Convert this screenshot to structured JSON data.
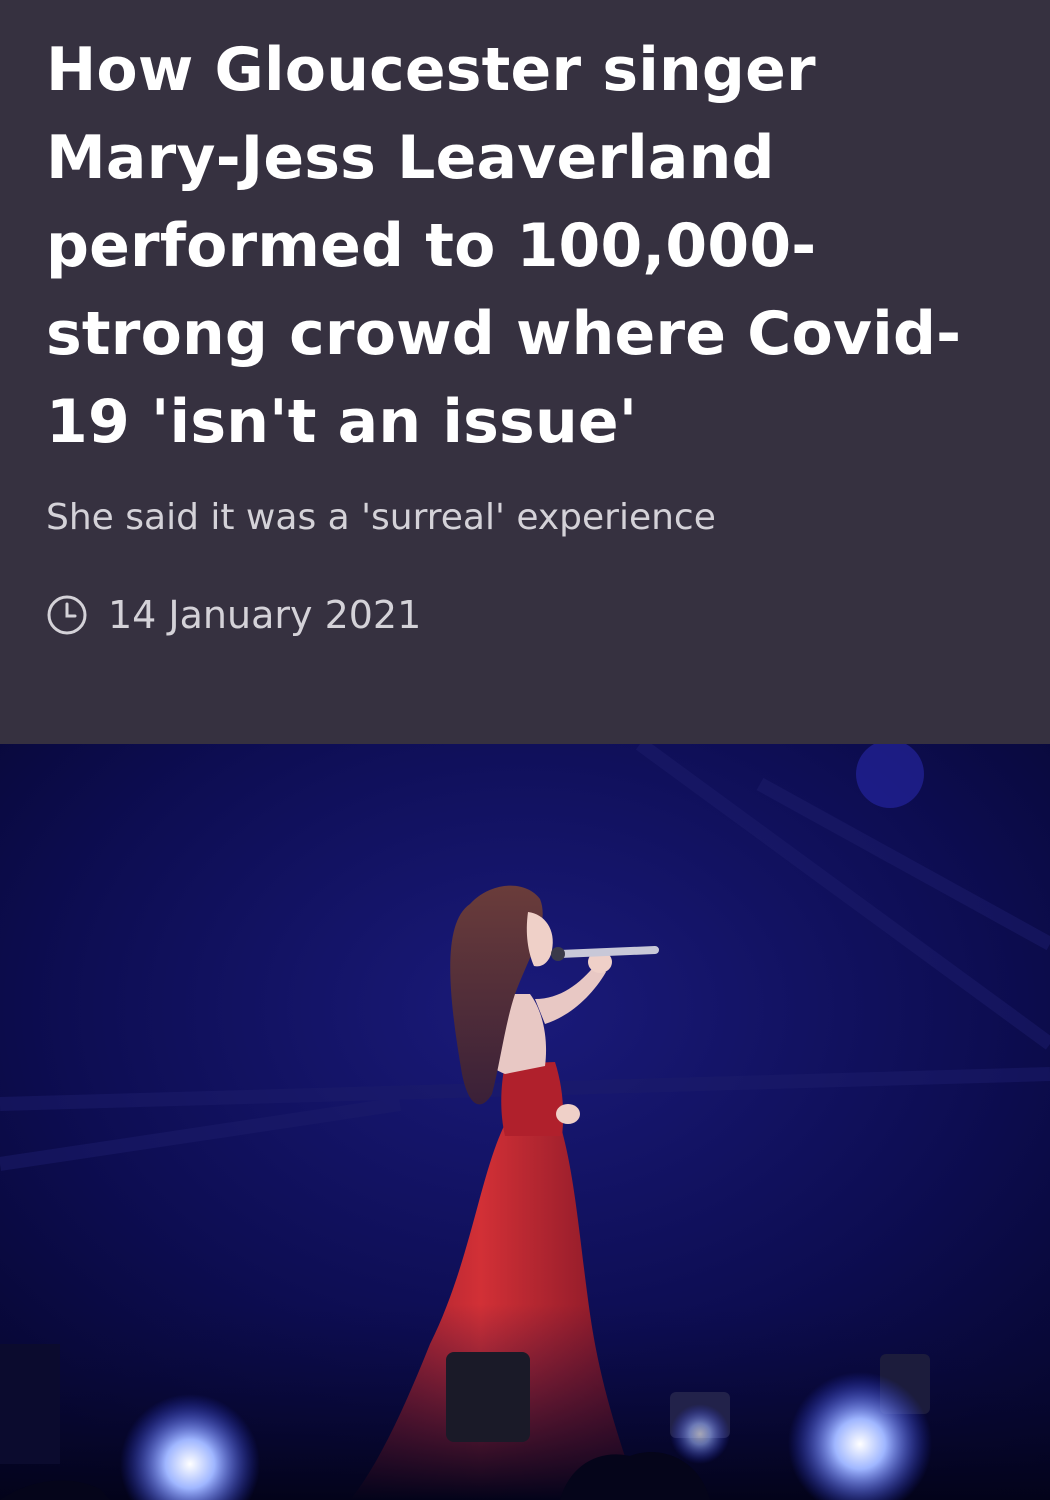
{
  "article": {
    "headline": "How Gloucester singer Mary-Jess Leaverland performed to 100,000-strong crowd where Covid-19 'isn't an issue'",
    "standfirst": "She said it was a 'surreal' experience",
    "date": "14 January 2021",
    "date_icon": "clock-icon"
  },
  "colors": {
    "header_bg": "#363140",
    "headline": "#ffffff",
    "meta_text": "#d4d2d8",
    "stage_blue": "#0c0c48",
    "dress_red": "#c0262c"
  }
}
